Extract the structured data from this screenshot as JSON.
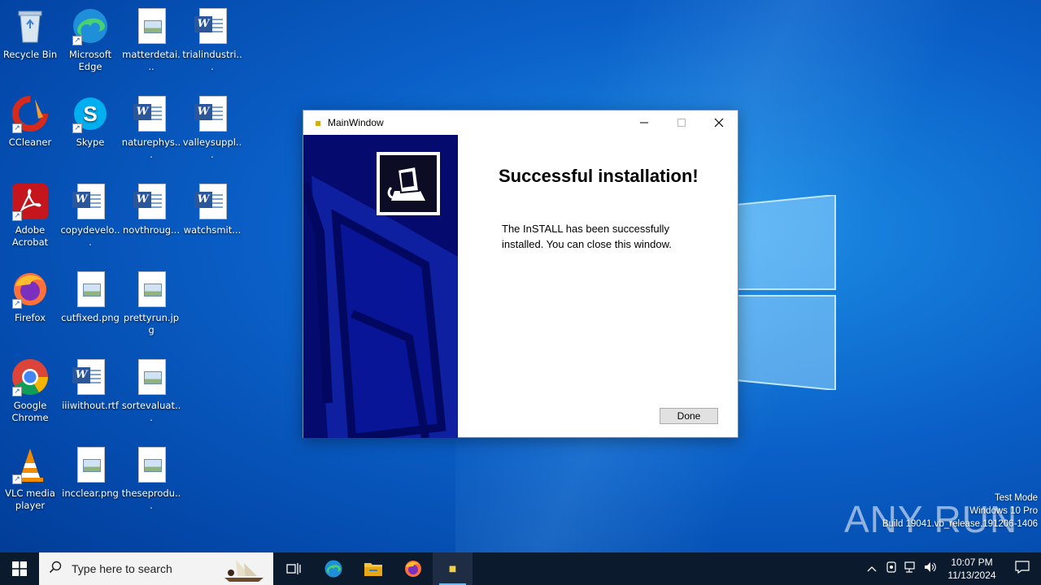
{
  "desktop": {
    "icons": [
      {
        "label": "Recycle Bin",
        "icon": "recycle-bin-icon"
      },
      {
        "label": "Microsoft Edge",
        "icon": "edge-icon"
      },
      {
        "label": "matterdetai...",
        "icon": "image-file-icon"
      },
      {
        "label": "trialindustri...",
        "icon": "word-doc-icon"
      },
      {
        "label": "CCleaner",
        "icon": "ccleaner-icon"
      },
      {
        "label": "Skype",
        "icon": "skype-icon"
      },
      {
        "label": "naturephys...",
        "icon": "word-doc-icon"
      },
      {
        "label": "valleysuppl...",
        "icon": "word-doc-icon"
      },
      {
        "label": "Adobe Acrobat",
        "icon": "adobe-acrobat-icon"
      },
      {
        "label": "copydevelo...",
        "icon": "word-doc-icon"
      },
      {
        "label": "novthroug...",
        "icon": "word-doc-icon"
      },
      {
        "label": "watchsmit...",
        "icon": "word-doc-icon"
      },
      {
        "label": "Firefox",
        "icon": "firefox-icon"
      },
      {
        "label": "cutfixed.png",
        "icon": "image-file-icon"
      },
      {
        "label": "prettyrun.jpg",
        "icon": "image-file-icon"
      },
      {
        "label": "Google Chrome",
        "icon": "chrome-icon"
      },
      {
        "label": "iiiwithout.rtf",
        "icon": "word-doc-icon"
      },
      {
        "label": "sortevaluat...",
        "icon": "image-file-icon"
      },
      {
        "label": "VLC media player",
        "icon": "vlc-icon"
      },
      {
        "label": "incclear.png",
        "icon": "image-file-icon"
      },
      {
        "label": "theseprodu...",
        "icon": "image-file-icon"
      }
    ]
  },
  "window": {
    "title": "MainWindow",
    "heading": "Successful installation!",
    "message": "The InSTALL has been successfully installed. You can close this window.",
    "done_label": "Done"
  },
  "watermark": {
    "brand": "ANY RUN",
    "mode": "Test Mode",
    "edition": "Windows 10 Pro",
    "build": "Build 19041.vb_release.191206-1406"
  },
  "taskbar": {
    "search_placeholder": "Type here to search",
    "time": "10:07 PM",
    "date": "11/13/2024"
  },
  "colors": {
    "accent": "#0a5fc7",
    "banner": "#050a6e",
    "taskbar": "#0c1a2e"
  }
}
